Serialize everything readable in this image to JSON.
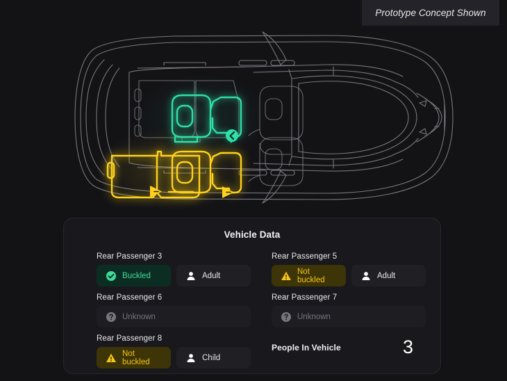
{
  "banner": {
    "text": "Prototype Concept Shown"
  },
  "vehicle_diagram": {
    "view": "overhead-vehicle-wireframe",
    "outline_color": "#8d8d96",
    "highlights": [
      {
        "seat": "Rear Passenger 3",
        "zone": "second-row-bench-left",
        "color": "#ffd21e",
        "state": "not-buckled",
        "badge_icon": "arrow-right-badge"
      },
      {
        "seat": "Rear Passenger 5",
        "zone": "third-row-left-outboard",
        "color": "#2fe0a8",
        "state": "buckled",
        "badge_icon": "seatbelt-badge"
      },
      {
        "seat": "Rear Passenger 8",
        "zone": "second-row-right-outboard",
        "color": "#ffd21e",
        "state": "not-buckled",
        "badge_icon": "arrow-right-badge"
      }
    ]
  },
  "panel": {
    "title": "Vehicle Data",
    "seats": [
      {
        "label": "Rear Passenger 3",
        "status": {
          "text": "Buckled",
          "icon": "check-circle-icon",
          "kind": "buckled"
        },
        "occupant": {
          "text": "Adult",
          "icon": "person-icon"
        }
      },
      {
        "label": "Rear Passenger 5",
        "status": {
          "text": "Not buckled",
          "icon": "warning-triangle-icon",
          "kind": "notbuckled"
        },
        "occupant": {
          "text": "Adult",
          "icon": "person-icon"
        }
      },
      {
        "label": "Rear Passenger 6",
        "status": {
          "text": "Unknown",
          "icon": "question-circle-icon",
          "kind": "unknown"
        },
        "occupant": null
      },
      {
        "label": "Rear Passenger 7",
        "status": {
          "text": "Unknown",
          "icon": "question-circle-icon",
          "kind": "unknown"
        },
        "occupant": null
      },
      {
        "label": "Rear Passenger 8",
        "status": {
          "text": "Not buckled",
          "icon": "warning-triangle-icon",
          "kind": "notbuckled"
        },
        "occupant": {
          "text": "Child",
          "icon": "person-icon"
        }
      }
    ],
    "people_in_vehicle": {
      "label": "People In Vehicle",
      "count": "3"
    }
  },
  "colors": {
    "page_background": "#131316",
    "panel_background": "#19191d",
    "chip_background": "#1f1f24",
    "buckled_green": "#3ddc9a",
    "buckled_green_bg": "#0c2e22",
    "not_buckled_yellow": "#f5c518",
    "not_buckled_bg": "#3d3408",
    "unknown_gray": "#76767e",
    "banner_background": "#232329"
  }
}
